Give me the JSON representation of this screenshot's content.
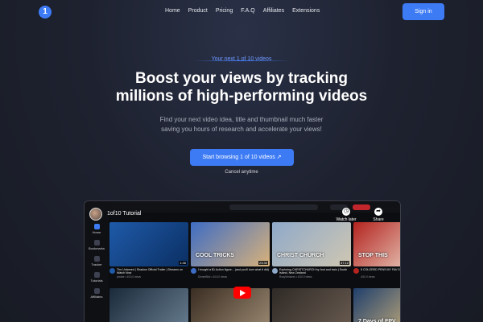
{
  "brand": {
    "logo_glyph": "1"
  },
  "nav": {
    "links": [
      "Home",
      "Product",
      "Pricing",
      "F.A.Q",
      "Affiliates",
      "Extensions"
    ],
    "signin": "Sign in"
  },
  "hero": {
    "eyebrow": "Your next 1 of 10 videos",
    "headline_line1": "Boost your views by tracking",
    "headline_line2": "millions of high-performing videos",
    "sub_line1": "Find your next video idea, title and thumbnail much faster",
    "sub_line2": "saving you hours of research and accelerate your views!",
    "cta": "Start browsing 1 of 10 videos  ↗",
    "cancel": "Cancel anytime"
  },
  "app": {
    "overlay_title": "1of10 Tutorial",
    "tools": [
      {
        "label": "Watch later",
        "icon": "clock-icon",
        "glyph": "◷"
      },
      {
        "label": "Share",
        "icon": "share-icon",
        "glyph": "➦"
      }
    ],
    "sidebar": [
      "Home",
      "Bookmarks",
      "Tracker",
      "Tutorials",
      "Affiliates"
    ],
    "videos_row1": [
      {
        "title": "The Untamed | Shadow Official Trailer | Streams on Watch Now",
        "sub": "pixabe • 4/10.0 views",
        "duration": "1:46",
        "colors": [
          "#1e5aa8",
          "#0b2f63"
        ],
        "overlay": ""
      },
      {
        "title": "I bought a $1 Action figure... (and you'll love what it did)",
        "sub": "DinnerBlitz • 4/10.0 views",
        "duration": "23:30",
        "colors": [
          "#3e6cc4",
          "#d8b27a"
        ],
        "overlay": "COOL TRICKS"
      },
      {
        "title": "Exploring CHRISTCHURCH by foot and train | South Island, New Zealand",
        "sub": "RosyVentures • 4/10.0 views",
        "duration": "37:12",
        "colors": [
          "#8fa9c9",
          "#cfc7b2"
        ],
        "overlay": "CHRIST CHURCH"
      },
      {
        "title": "5 COLORED PENS MY FAV Designing",
        "sub": "4/10.0 views",
        "duration": "5:56",
        "colors": [
          "#b3231f",
          "#f0e3d2"
        ],
        "overlay": "STOP THIS"
      }
    ],
    "videos_row2": [
      {
        "colors": [
          "#1a2a3a",
          "#6a7f92"
        ],
        "overlay": ""
      },
      {
        "colors": [
          "#3a2d22",
          "#9c8a73"
        ],
        "overlay": ""
      },
      {
        "colors": [
          "#2f2a26",
          "#6a5c52"
        ],
        "overlay": ""
      },
      {
        "colors": [
          "#1f3f6c",
          "#e9c47e"
        ],
        "overlay": "7 Days of FPV"
      }
    ]
  }
}
